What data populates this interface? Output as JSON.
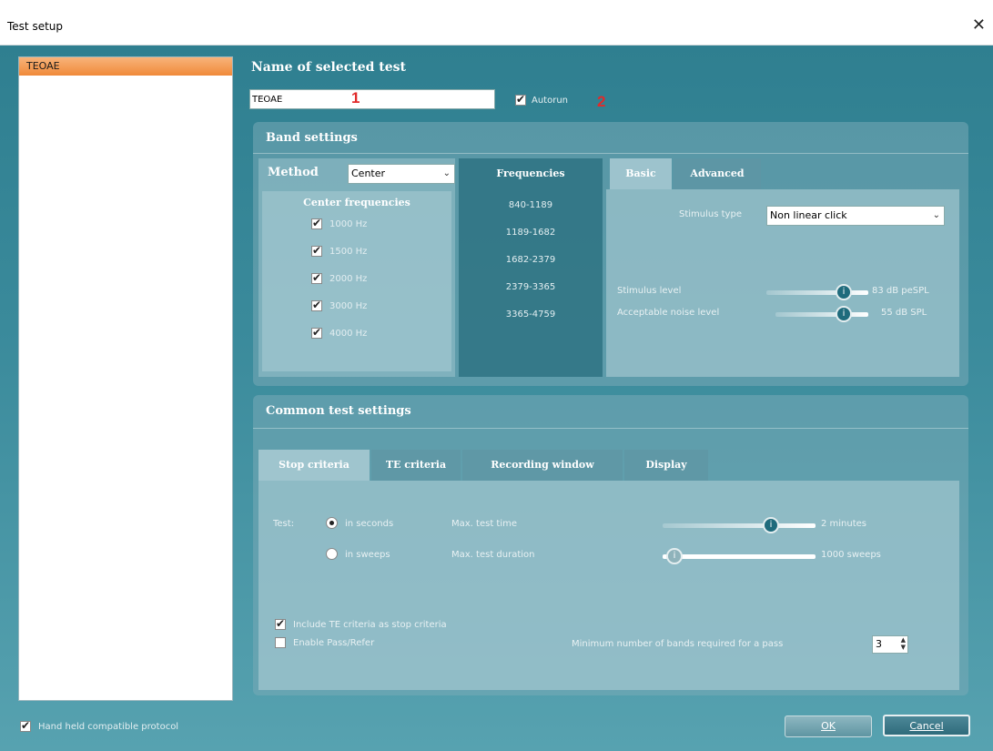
{
  "window": {
    "title": "Test setup",
    "close_glyph": "✕"
  },
  "test_list": {
    "items": [
      "TEOAE"
    ]
  },
  "name_section": {
    "heading": "Name of selected test",
    "name_value": "TEOAE",
    "autorun_label": "Autorun",
    "autorun_checked": true,
    "marker_1": "1",
    "marker_2": "2"
  },
  "band_settings": {
    "heading": "Band settings",
    "method_label": "Method",
    "method_value": "Center",
    "center_freq_title": "Center frequencies",
    "center_freqs": [
      {
        "label": "1000 Hz",
        "checked": true
      },
      {
        "label": "1500 Hz",
        "checked": true
      },
      {
        "label": "2000 Hz",
        "checked": true
      },
      {
        "label": "3000 Hz",
        "checked": true
      },
      {
        "label": "4000 Hz",
        "checked": true
      }
    ],
    "frequencies_title": "Frequencies",
    "frequency_ranges": [
      "840-1189",
      "1189-1682",
      "1682-2379",
      "2379-3365",
      "3365-4759"
    ],
    "tabs": [
      "Basic",
      "Advanced"
    ],
    "active_tab": "Basic",
    "stimulus_type_label": "Stimulus type",
    "stimulus_type_value": "Non linear click",
    "stimulus_level_label": "Stimulus level",
    "stimulus_level_value": "83 dB peSPL",
    "noise_level_label": "Acceptable noise level",
    "noise_level_value": "55 dB SPL"
  },
  "common_settings": {
    "heading": "Common test settings",
    "tabs": [
      "Stop criteria",
      "TE criteria",
      "Recording window",
      "Display"
    ],
    "active_tab": "Stop criteria",
    "test_label": "Test:",
    "radio_seconds": "in seconds",
    "radio_sweeps": "in sweeps",
    "radio_selected": "in seconds",
    "max_time_label": "Max. test time",
    "max_time_value": "2 minutes",
    "max_duration_label": "Max. test duration",
    "max_duration_value": "1000 sweeps",
    "include_te_label": "Include TE criteria as stop criteria",
    "include_te_checked": true,
    "pass_refer_label": "Enable Pass/Refer",
    "pass_refer_checked": false,
    "min_bands_label": "Minimum number of bands required for a pass",
    "min_bands_value": "3"
  },
  "footer": {
    "handheld_label": "Hand held compatible protocol",
    "handheld_checked": true,
    "ok_label": "OK",
    "cancel_label": "Cancel"
  },
  "colors": {
    "background": "#2e7a8c",
    "selected_item": "#f08a3a",
    "marker": "#e12a2a"
  }
}
